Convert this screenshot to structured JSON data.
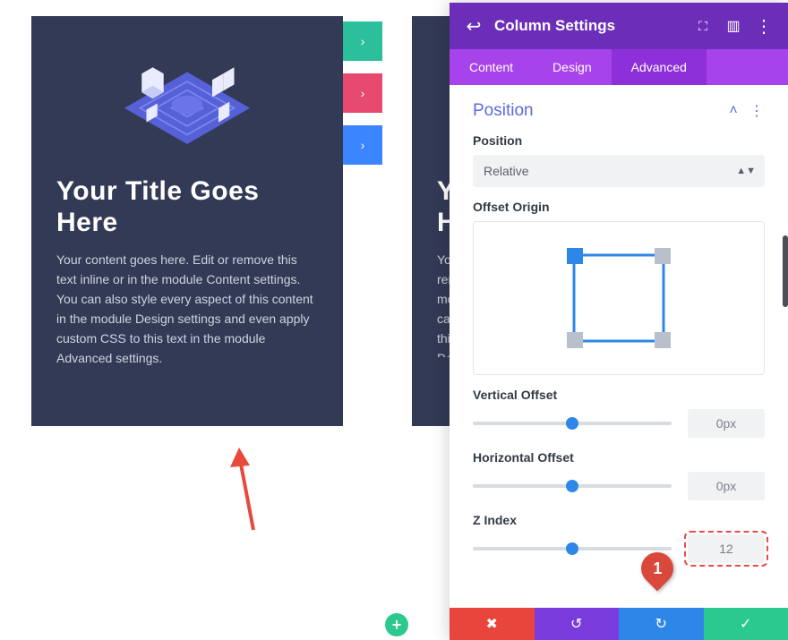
{
  "canvas": {
    "card_title": "Your Title Goes Here",
    "card_body": "Your content goes here. Edit or remove this text inline or in the module Content settings. You can also style every aspect of this content in the module Design settings and even apply custom CSS to this text in the module Advanced settings.",
    "card_b_title": "Y\nH",
    "add_glyph": "+"
  },
  "panel": {
    "title": "Column Settings",
    "tabs": [
      "Content",
      "Design",
      "Advanced"
    ],
    "active_tab": 2,
    "section": "Position",
    "position": {
      "label": "Position",
      "value": "Relative"
    },
    "origin_label": "Offset Origin",
    "vertical": {
      "label": "Vertical Offset",
      "value": "0px"
    },
    "horizontal": {
      "label": "Horizontal Offset",
      "value": "0px"
    },
    "zindex": {
      "label": "Z Index",
      "value": "12"
    }
  },
  "callouts": {
    "c1": "1"
  },
  "icons": {
    "back": "↩",
    "expand": "⛶",
    "drag": "▥",
    "more": "⋮",
    "chevup": "˄",
    "dots": "⋮",
    "x": "✖",
    "undo": "↺",
    "redo": "↻",
    "check": "✓",
    "chevr": "›"
  }
}
